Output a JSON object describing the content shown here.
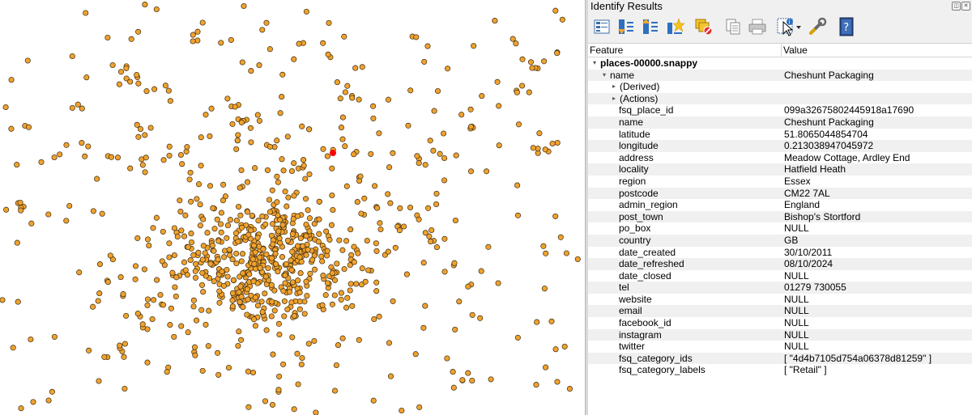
{
  "panel": {
    "title": "Identify Results",
    "title_buttons": [
      "restore-icon",
      "close-icon"
    ]
  },
  "toolbar": {
    "tools": [
      {
        "id": "expand-tree",
        "icon": "tree-expand-icon"
      },
      {
        "id": "collapse-all",
        "icon": "collapse-icon"
      },
      {
        "id": "expand-all",
        "icon": "expand-icon"
      },
      {
        "id": "expand-new",
        "icon": "star-expand-icon"
      },
      {
        "id": "clear-results",
        "icon": "clear-results-icon"
      },
      {
        "id": "copy-feature",
        "icon": "copy-icon"
      },
      {
        "id": "print",
        "icon": "print-icon"
      },
      {
        "id": "identify-mode",
        "icon": "identify-cursor-icon"
      },
      {
        "id": "identify-settings",
        "icon": "wrench-icon"
      },
      {
        "id": "help",
        "icon": "help-icon"
      }
    ],
    "help_label": "?"
  },
  "tree": {
    "headers": {
      "feature": "Feature",
      "value": "Value"
    },
    "rows": [
      {
        "feature": "places-00000.snappy",
        "value": "",
        "level": 0,
        "arrow": "expanded",
        "bold": true
      },
      {
        "feature": "name",
        "value": "Cheshunt Packaging",
        "level": 1,
        "arrow": "expanded"
      },
      {
        "feature": "(Derived)",
        "value": "",
        "level": 2,
        "arrow": "collapsed"
      },
      {
        "feature": "(Actions)",
        "value": "",
        "level": 2,
        "arrow": "collapsed"
      },
      {
        "feature": "fsq_place_id",
        "value": "099a32675802445918a17690",
        "level": 2
      },
      {
        "feature": "name",
        "value": "Cheshunt Packaging",
        "level": 2
      },
      {
        "feature": "latitude",
        "value": "51.8065044854704",
        "level": 2
      },
      {
        "feature": "longitude",
        "value": "0.213038947045972",
        "level": 2
      },
      {
        "feature": "address",
        "value": "Meadow Cottage, Ardley End",
        "level": 2
      },
      {
        "feature": "locality",
        "value": "Hatfield Heath",
        "level": 2
      },
      {
        "feature": "region",
        "value": "Essex",
        "level": 2
      },
      {
        "feature": "postcode",
        "value": "CM22 7AL",
        "level": 2
      },
      {
        "feature": "admin_region",
        "value": "England",
        "level": 2
      },
      {
        "feature": "post_town",
        "value": "Bishop's Stortford",
        "level": 2
      },
      {
        "feature": "po_box",
        "value": "NULL",
        "level": 2
      },
      {
        "feature": "country",
        "value": "GB",
        "level": 2
      },
      {
        "feature": "date_created",
        "value": "30/10/2011",
        "level": 2
      },
      {
        "feature": "date_refreshed",
        "value": "08/10/2024",
        "level": 2
      },
      {
        "feature": "date_closed",
        "value": "NULL",
        "level": 2
      },
      {
        "feature": "tel",
        "value": "01279 730055",
        "level": 2
      },
      {
        "feature": "website",
        "value": "NULL",
        "level": 2
      },
      {
        "feature": "email",
        "value": "NULL",
        "level": 2
      },
      {
        "feature": "facebook_id",
        "value": "NULL",
        "level": 2
      },
      {
        "feature": "instagram",
        "value": "NULL",
        "level": 2
      },
      {
        "feature": "twitter",
        "value": "NULL",
        "level": 2
      },
      {
        "feature": "fsq_category_ids",
        "value": "[ \"4d4b7105d754a06378d81259\" ]",
        "level": 2
      },
      {
        "feature": "fsq_category_labels",
        "value": "[ \"Retail\" ]",
        "level": 2
      }
    ]
  },
  "map": {
    "point_fill": "#f0a22e",
    "point_stroke": "#3a2a10",
    "selected_fill": "#ff0000",
    "background": "#ffffff"
  }
}
